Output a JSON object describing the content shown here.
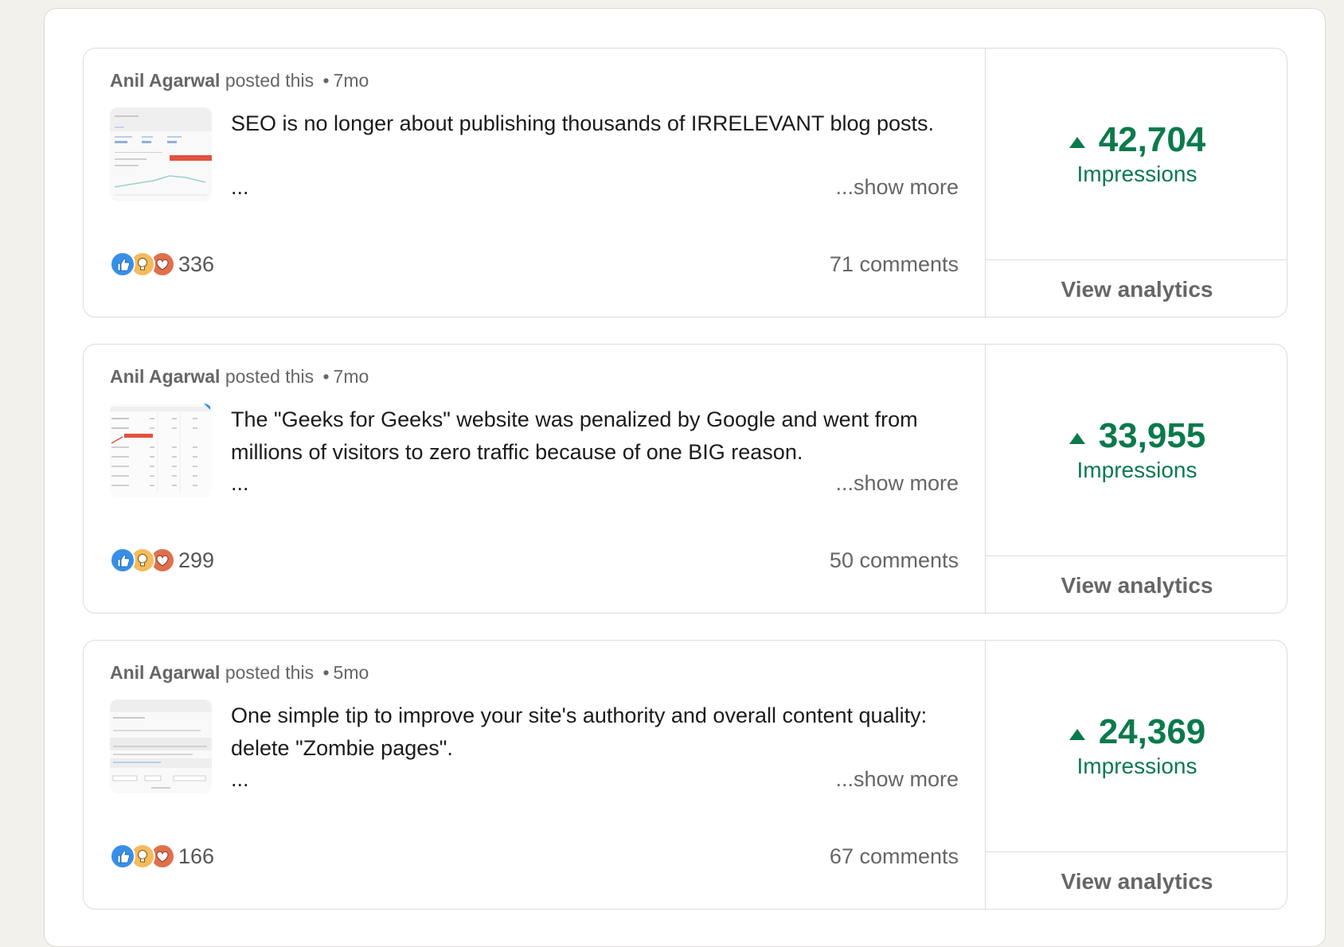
{
  "posts": [
    {
      "author": "Anil Agarwal",
      "action": "posted this",
      "separator": "•",
      "age": "7mo",
      "thumbnail_icon": "analytics-chart-screenshot",
      "text": "SEO is no longer about publishing thousands of IRRELEVANT blog posts.",
      "ellipsis": "...",
      "show_more": "...show more",
      "reaction_icons": [
        "like-icon",
        "insightful-icon",
        "love-icon"
      ],
      "reaction_count": "336",
      "comments": "71 comments",
      "impressions": "42,704",
      "impressions_label": "Impressions",
      "view_analytics": "View analytics"
    },
    {
      "author": "Anil Agarwal",
      "action": "posted this",
      "separator": "•",
      "age": "7mo",
      "thumbnail_icon": "table-screenshot",
      "text": "The \"Geeks for Geeks\" website was penalized by Google and went from millions of visitors to zero traffic because of one BIG reason.",
      "ellipsis": "...",
      "show_more": "...show more",
      "reaction_icons": [
        "like-icon",
        "insightful-icon",
        "love-icon"
      ],
      "reaction_count": "299",
      "comments": "50 comments",
      "impressions": "33,955",
      "impressions_label": "Impressions",
      "view_analytics": "View analytics"
    },
    {
      "author": "Anil Agarwal",
      "action": "posted this",
      "separator": "•",
      "age": "5mo",
      "thumbnail_icon": "page-screenshot",
      "text": "One simple tip to improve your site's authority and overall content quality: delete \"Zombie pages\".",
      "ellipsis": "...",
      "show_more": "...show more",
      "reaction_icons": [
        "like-icon",
        "insightful-icon",
        "love-icon"
      ],
      "reaction_count": "166",
      "comments": "67 comments",
      "impressions": "24,369",
      "impressions_label": "Impressions",
      "view_analytics": "View analytics"
    }
  ],
  "colors": {
    "impressions_green": "#0a7a4c",
    "like_blue": "#378fe9",
    "insight_yellow": "#f5bb5c",
    "love_red": "#df704d",
    "page_bg": "#f3f1ec"
  }
}
